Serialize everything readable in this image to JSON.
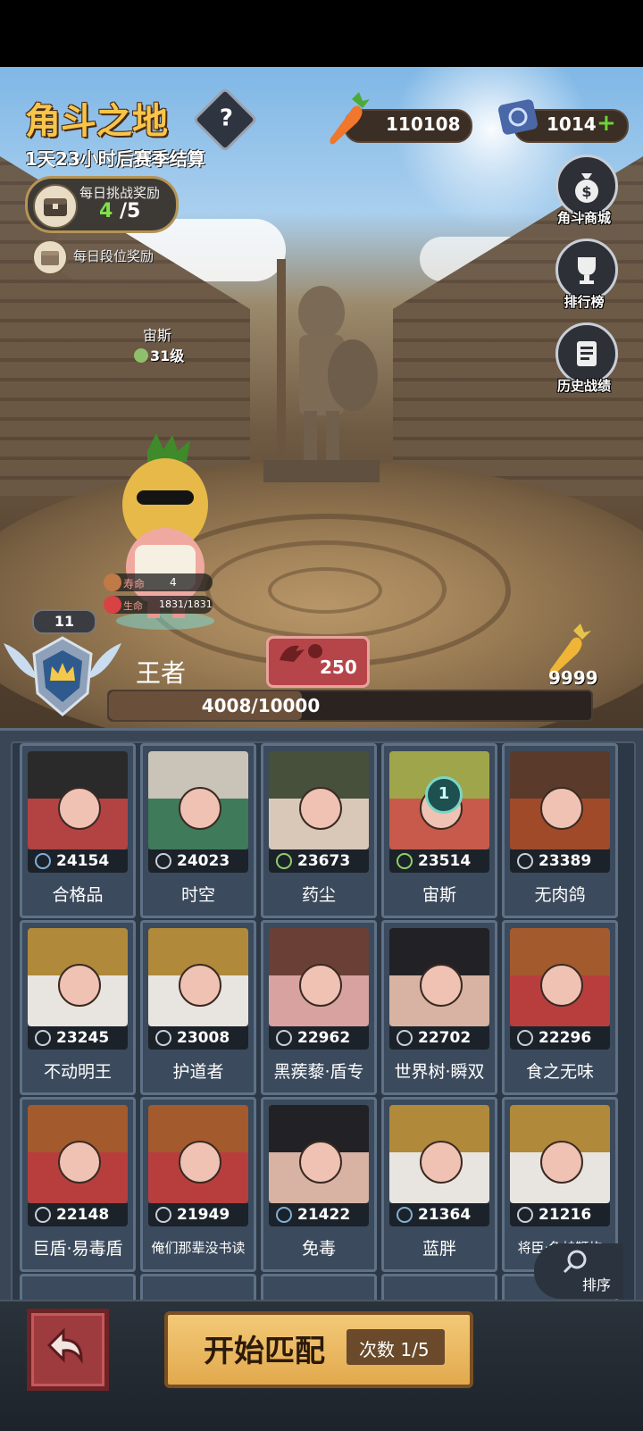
{
  "header": {
    "title": "角斗之地",
    "help": "?",
    "season_countdown": "1天23小时后赛季结算",
    "daily_challenge": {
      "label": "每日挑战奖励",
      "current": "4",
      "total": "/5"
    },
    "daily_rank_reward": "每日段位奖励"
  },
  "currencies": {
    "carrot": "110108",
    "ticket": "1014",
    "ticket_plus": "+"
  },
  "right_menu": [
    {
      "label": "角斗商城",
      "icon": "money-bag-icon"
    },
    {
      "label": "排行榜",
      "icon": "trophy-icon"
    },
    {
      "label": "历史战绩",
      "icon": "scroll-icon"
    }
  ],
  "hero": {
    "name": "宙斯",
    "level": "31级",
    "lifespan_label": "寿命",
    "lifespan_value": "4",
    "hp_label": "生命",
    "hp_value": "1831/1831"
  },
  "rank": {
    "number": "11",
    "name": "王者",
    "points": "250",
    "gold_carrot": "9999",
    "progress_text": "4008/10000",
    "progress_fraction": 0.4008
  },
  "opponents": [
    {
      "name": "合格品",
      "power": "24154",
      "icon": "claw-icon",
      "colors": [
        "#2a2a2a",
        "#b34242"
      ]
    },
    {
      "name": "时空",
      "power": "24023",
      "icon": "sword-icon",
      "colors": [
        "#c9c3b8",
        "#3f7a5a"
      ]
    },
    {
      "name": "药尘",
      "power": "23673",
      "icon": "leaf-icon",
      "colors": [
        "#46503a",
        "#d9c8b8"
      ]
    },
    {
      "name": "宙斯",
      "power": "23514",
      "icon": "leaf-icon",
      "colors": [
        "#9fa54a",
        "#c75a4a"
      ],
      "badge": "1"
    },
    {
      "name": "无肉鸽",
      "power": "23389",
      "icon": "sword-icon",
      "colors": [
        "#5a3a2a",
        "#a04a2a"
      ]
    },
    {
      "name": "不动明王",
      "power": "23245",
      "icon": "target-icon",
      "colors": [
        "#b08a3a",
        "#e8e4df"
      ]
    },
    {
      "name": "护道者",
      "power": "23008",
      "icon": "sword-icon",
      "colors": [
        "#b08a3a",
        "#e8e4df"
      ]
    },
    {
      "name": "黑蒺藜·盾专",
      "power": "22962",
      "icon": "sword-icon",
      "colors": [
        "#6a4036",
        "#d8a2a0"
      ]
    },
    {
      "name": "世界树·瞬双",
      "power": "22702",
      "icon": "target-icon",
      "colors": [
        "#222226",
        "#d8b2a2"
      ]
    },
    {
      "name": "食之无味",
      "power": "22296",
      "icon": "sword-icon",
      "colors": [
        "#a35a2c",
        "#b83e3e"
      ]
    },
    {
      "name": "巨盾·易毒盾",
      "power": "22148",
      "icon": "sword-icon",
      "colors": [
        "#a35a2c",
        "#b83e3e"
      ]
    },
    {
      "name": "俺们那辈没书读",
      "power": "21949",
      "icon": "target-icon",
      "colors": [
        "#a35a2c",
        "#b83e3e"
      ]
    },
    {
      "name": "免毒",
      "power": "21422",
      "icon": "claw-icon",
      "colors": [
        "#222226",
        "#d8b2a2"
      ]
    },
    {
      "name": "蓝胖",
      "power": "21364",
      "icon": "claw-icon",
      "colors": [
        "#b08a3a",
        "#e8e4df"
      ]
    },
    {
      "name": "将臣·鱼蛙鞭炮",
      "power": "21216",
      "icon": "target-icon",
      "colors": [
        "#b08a3a",
        "#e8e4df"
      ]
    }
  ],
  "sort_label": "排序",
  "bottom": {
    "match_label": "开始匹配",
    "count_label": "次数 1/5"
  }
}
